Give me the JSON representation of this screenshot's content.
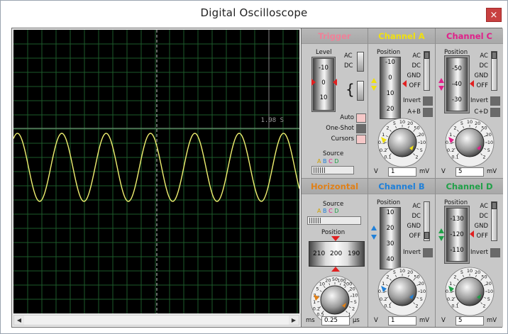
{
  "window": {
    "title": "Digital Oscilloscope",
    "close_glyph": "×"
  },
  "screen": {
    "time_readout": "1.98 S",
    "scroll_left": "◀",
    "scroll_right": "▶"
  },
  "trigger": {
    "title": "Trigger",
    "title_color": "#f08098",
    "level_label": "Level",
    "level_values": [
      "-10",
      "0",
      "10"
    ],
    "ac": "AC",
    "dc": "DC",
    "auto": "Auto",
    "one_shot": "One-Shot",
    "cursors": "Cursors",
    "source_label": "Source",
    "sources": [
      "A",
      "B",
      "C",
      "D"
    ]
  },
  "channel_a": {
    "title": "Channel A",
    "title_color": "#f0e010",
    "position_label": "Position",
    "position_values": [
      "-10",
      "0",
      "10",
      "20"
    ],
    "ac": "AC",
    "dc": "DC",
    "gnd": "GND",
    "off": "OFF",
    "invert": "Invert",
    "combine": "A+B",
    "knob_scale": [
      "0.1",
      "0.2",
      "0.5",
      "1",
      "2",
      "5",
      "10",
      "20",
      "50",
      "20",
      "10",
      "5",
      "2"
    ],
    "unit_left": "V",
    "value": "1",
    "unit_right": "mV"
  },
  "channel_c": {
    "title": "Channel C",
    "title_color": "#e0208a",
    "position_label": "Position",
    "position_values": [
      "-50",
      "-40",
      "-30"
    ],
    "ac": "AC",
    "dc": "DC",
    "gnd": "GND",
    "off": "OFF",
    "invert": "Invert",
    "combine": "C+D",
    "knob_scale": [
      "0.1",
      "0.2",
      "0.5",
      "1",
      "2",
      "5",
      "10",
      "20",
      "50",
      "20",
      "10",
      "5",
      "2"
    ],
    "unit_left": "V",
    "value": "5",
    "unit_right": "mV"
  },
  "horizontal": {
    "title": "Horizontal",
    "title_color": "#e08018",
    "source_label": "Source",
    "sources": [
      "A",
      "B",
      "C",
      "D"
    ],
    "position_label": "Position",
    "position_values": [
      "210",
      "200",
      "190"
    ],
    "knob_scale": [
      "0.5",
      "0.2",
      "1",
      "2",
      "5",
      "10",
      "20",
      "50",
      "100",
      "200",
      "20",
      "10",
      "5",
      "2",
      "1"
    ],
    "unit_left": "ms",
    "value": "0.25",
    "unit_right": "µs"
  },
  "channel_b": {
    "title": "Channel B",
    "title_color": "#2080d8",
    "position_label": "Position",
    "position_values": [
      "10",
      "20",
      "30",
      "40"
    ],
    "ac": "AC",
    "dc": "DC",
    "gnd": "GND",
    "off": "OFF",
    "invert": "Invert",
    "knob_scale": [
      "0.1",
      "0.2",
      "0.5",
      "1",
      "2",
      "5",
      "10",
      "20",
      "50",
      "20",
      "10",
      "5",
      "2"
    ],
    "unit_left": "V",
    "value": "1",
    "unit_right": "mV"
  },
  "channel_d": {
    "title": "Channel D",
    "title_color": "#20a048",
    "position_label": "Position",
    "position_values": [
      "-130",
      "-120",
      "-110"
    ],
    "ac": "AC",
    "dc": "DC",
    "gnd": "GND",
    "off": "OFF",
    "invert": "Invert",
    "knob_scale": [
      "0.1",
      "0.2",
      "0.5",
      "1",
      "2",
      "5",
      "10",
      "20",
      "50",
      "20",
      "10",
      "5",
      "2"
    ],
    "unit_left": "V",
    "value": "5",
    "unit_right": "mV"
  },
  "colors": {
    "trace": "#f0f070",
    "grid": "#1d5a2a",
    "screen": "#000000"
  }
}
